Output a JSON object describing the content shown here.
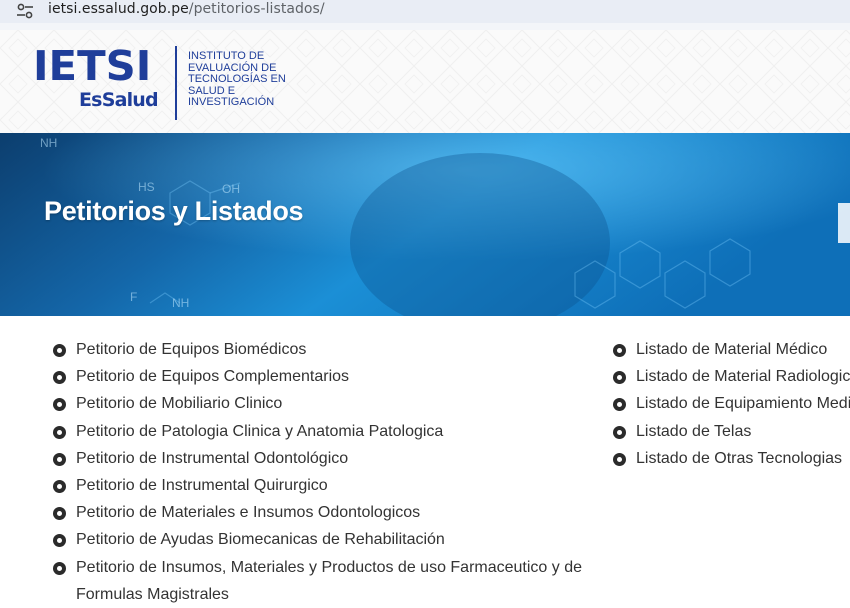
{
  "browser": {
    "url_host": "ietsi.essalud.gob.pe",
    "url_path": "/petitorios-listados/",
    "site_info_icon": "tune-icon"
  },
  "header": {
    "logo_main": "IETSI",
    "logo_sub": "EsSalud",
    "logo_text_lines": [
      "INSTITUTO DE",
      "EVALUACIÓN DE",
      "TECNOLOGÍAS EN",
      "SALUD E",
      "INVESTIGACIÓN"
    ],
    "brand_color": "#1f3e9a"
  },
  "banner": {
    "title": "Petitorios y Listados",
    "accent_color": "#1b8fd6"
  },
  "lists": {
    "left": [
      "Petitorio de Equipos Biomédicos",
      "Petitorio de Equipos Complementarios",
      "Petitorio de Mobiliario Clinico",
      "Petitorio de Patologia Clinica y Anatomia Patologica",
      "Petitorio de Instrumental Odontológico",
      "Petitorio de Instrumental Quirurgico",
      "Petitorio de Materiales e Insumos Odontologicos",
      "Petitorio de Ayudas Biomecanicas de Rehabilitación",
      "Petitorio de Insumos, Materiales y Productos de uso Farmaceutico y de Formulas Magistrales"
    ],
    "right": [
      "Listado de Material Médico",
      "Listado de Material Radiologico",
      "Listado de Equipamiento Medico",
      "Listado de Telas",
      "Listado de Otras Tecnologias"
    ]
  }
}
